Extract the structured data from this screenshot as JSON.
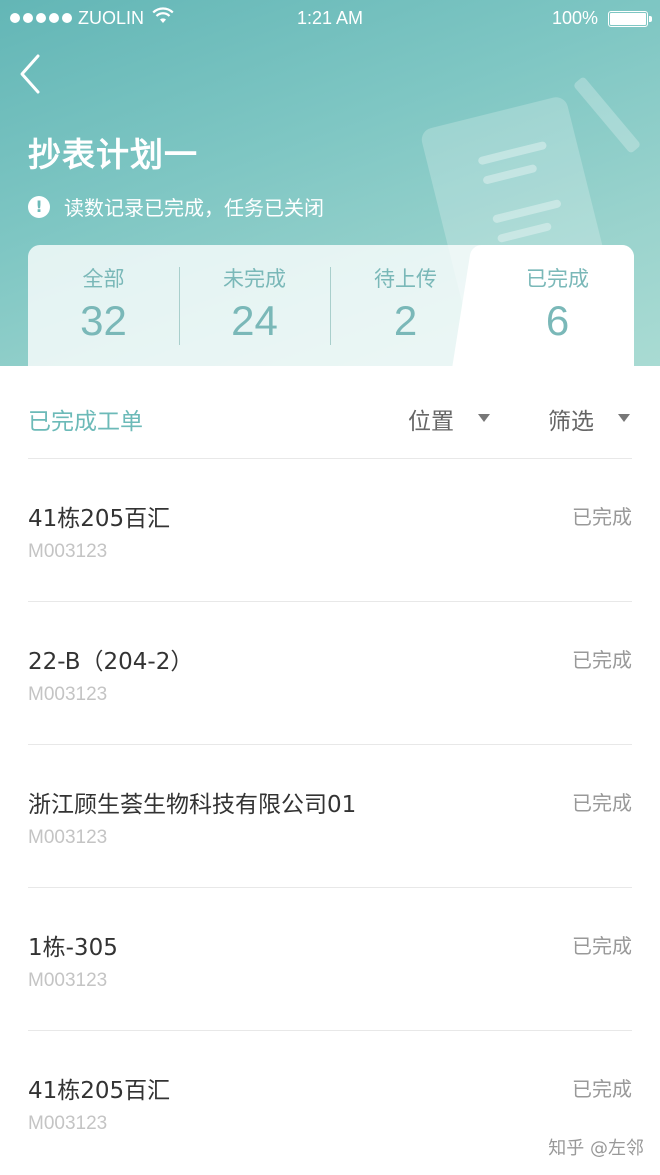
{
  "status_bar": {
    "carrier": "ZUOLIN",
    "time": "1:21 AM",
    "battery": "100%"
  },
  "header": {
    "title": "抄表计划一",
    "notice": "读数记录已完成，任务已关闭"
  },
  "tabs": [
    {
      "label": "全部",
      "count": "32"
    },
    {
      "label": "未完成",
      "count": "24"
    },
    {
      "label": "待上传",
      "count": "2"
    },
    {
      "label": "已完成",
      "count": "6"
    }
  ],
  "filter": {
    "title": "已完成工单",
    "position_label": "位置",
    "filter_label": "筛选"
  },
  "orders": [
    {
      "name": "41栋205百汇",
      "code": "M003123",
      "status": "已完成"
    },
    {
      "name": "22-B（204-2）",
      "code": "M003123",
      "status": "已完成"
    },
    {
      "name": "浙江顾生荟生物科技有限公司01",
      "code": "M003123",
      "status": "已完成"
    },
    {
      "name": "1栋-305",
      "code": "M003123",
      "status": "已完成"
    },
    {
      "name": "41栋205百汇",
      "code": "M003123",
      "status": "已完成"
    }
  ],
  "watermark": "知乎 @左邻",
  "colors": {
    "accent": "#6cbab8",
    "header_gradient_start": "#63b6b6",
    "header_gradient_end": "#a9dbd3"
  }
}
